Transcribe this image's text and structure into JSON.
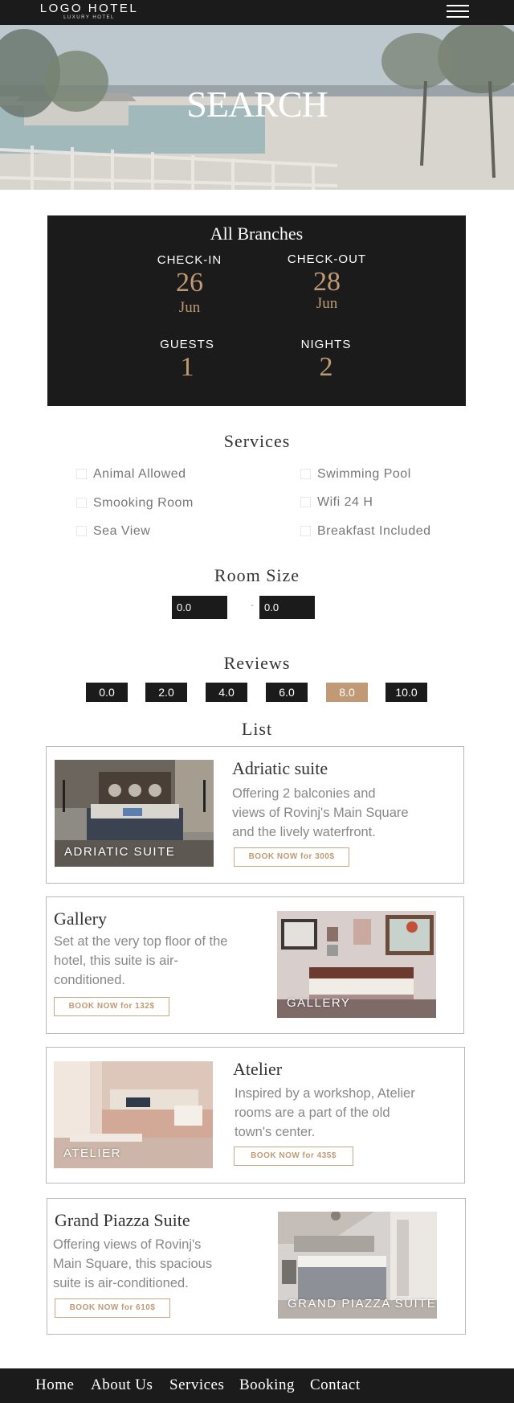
{
  "header": {
    "logo_main": "LOGO HOTEL",
    "logo_sub": "LUXURY HOTEL",
    "menu_icon": "hamburger-menu-icon"
  },
  "hero": {
    "title": "SEARCH"
  },
  "booking": {
    "branch": "All Branches",
    "checkin_label": "CHECK-IN",
    "checkin_day": "26",
    "checkin_month": "Jun",
    "checkout_label": "CHECK-OUT",
    "checkout_day": "28",
    "checkout_month": "Jun",
    "guests_label": "GUESTS",
    "guests": "1",
    "nights_label": "NIGHTS",
    "nights": "2"
  },
  "services": {
    "title": "Services",
    "items": [
      "Animal Allowed",
      "Swimming Pool",
      "Smooking Room",
      "Wifi 24 H",
      "Sea View",
      "Breakfast Included"
    ]
  },
  "room_size": {
    "title": "Room Size",
    "min": "0.0",
    "max": "0.0",
    "separator": "-"
  },
  "reviews": {
    "title": "Reviews",
    "options": [
      "0.0",
      "2.0",
      "4.0",
      "6.0",
      "8.0",
      "10.0"
    ],
    "selected": "8.0"
  },
  "list": {
    "title": "List",
    "rooms": [
      {
        "name": "Adriatic suite",
        "desc_lines": [
          "Offering 2 balconies and",
          "views of Rovinj's Main Square",
          "and the lively waterfront."
        ],
        "button": "BOOK NOW for 300$",
        "image_label": "ADRIATIC SUITE"
      },
      {
        "name": "Gallery",
        "desc_lines": [
          "Set at the very top floor of the",
          "hotel, this suite is air-",
          "conditioned."
        ],
        "button": "BOOK NOW for 132$",
        "image_label": "GALLERY"
      },
      {
        "name": "Atelier",
        "desc_lines": [
          "Inspired by a workshop, Atelier",
          "rooms are a part of the old",
          "town's center."
        ],
        "button": "BOOK NOW for 435$",
        "image_label": "ATELIER"
      },
      {
        "name": "Grand Piazza Suite",
        "desc_lines": [
          "Offering views of Rovinj's",
          "Main Square, this spacious",
          "suite is air-conditioned."
        ],
        "button": "BOOK NOW for 610$",
        "image_label": "GRAND PIAZZA SUITE"
      }
    ]
  },
  "footer": {
    "links": [
      "Home",
      "About Us",
      "Services",
      "Booking",
      "Contact"
    ]
  },
  "colors": {
    "dark": "#1b1b1b",
    "accent": "#c09a74",
    "border": "#b9b9b9"
  }
}
